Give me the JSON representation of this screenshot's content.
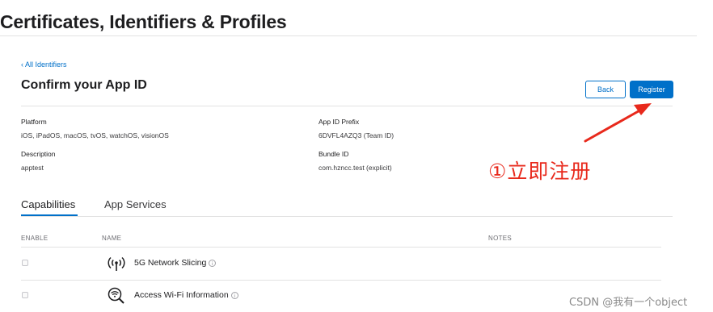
{
  "header": {
    "title": "Certificates, Identifiers & Profiles"
  },
  "nav": {
    "back_link": "‹ All Identifiers"
  },
  "section": {
    "heading": "Confirm your App ID"
  },
  "buttons": {
    "back_label": "Back",
    "register_label": "Register"
  },
  "details": {
    "platform_label": "Platform",
    "platform_value": "iOS, iPadOS, macOS, tvOS, watchOS, visionOS",
    "description_label": "Description",
    "description_value": "apptest",
    "prefix_label": "App ID Prefix",
    "prefix_value": "6DVFL4AZQ3 (Team ID)",
    "bundle_label": "Bundle ID",
    "bundle_value": "com.hzncc.test (explicit)"
  },
  "annotation": {
    "text": "①立即注册",
    "color": "#e8291c"
  },
  "tabs": [
    {
      "label": "Capabilities",
      "active": true
    },
    {
      "label": "App Services",
      "active": false
    }
  ],
  "table": {
    "columns": [
      "ENABLE",
      "NAME",
      "NOTES"
    ],
    "rows": [
      {
        "name": "5G Network Slicing",
        "icon": "antenna-signal-icon",
        "enabled": false
      },
      {
        "name": "Access Wi-Fi Information",
        "icon": "wifi-search-icon",
        "enabled": false
      }
    ]
  },
  "watermark": "CSDN @我有一个object",
  "colors": {
    "accent": "#0070c9",
    "annotation": "#e8291c"
  }
}
